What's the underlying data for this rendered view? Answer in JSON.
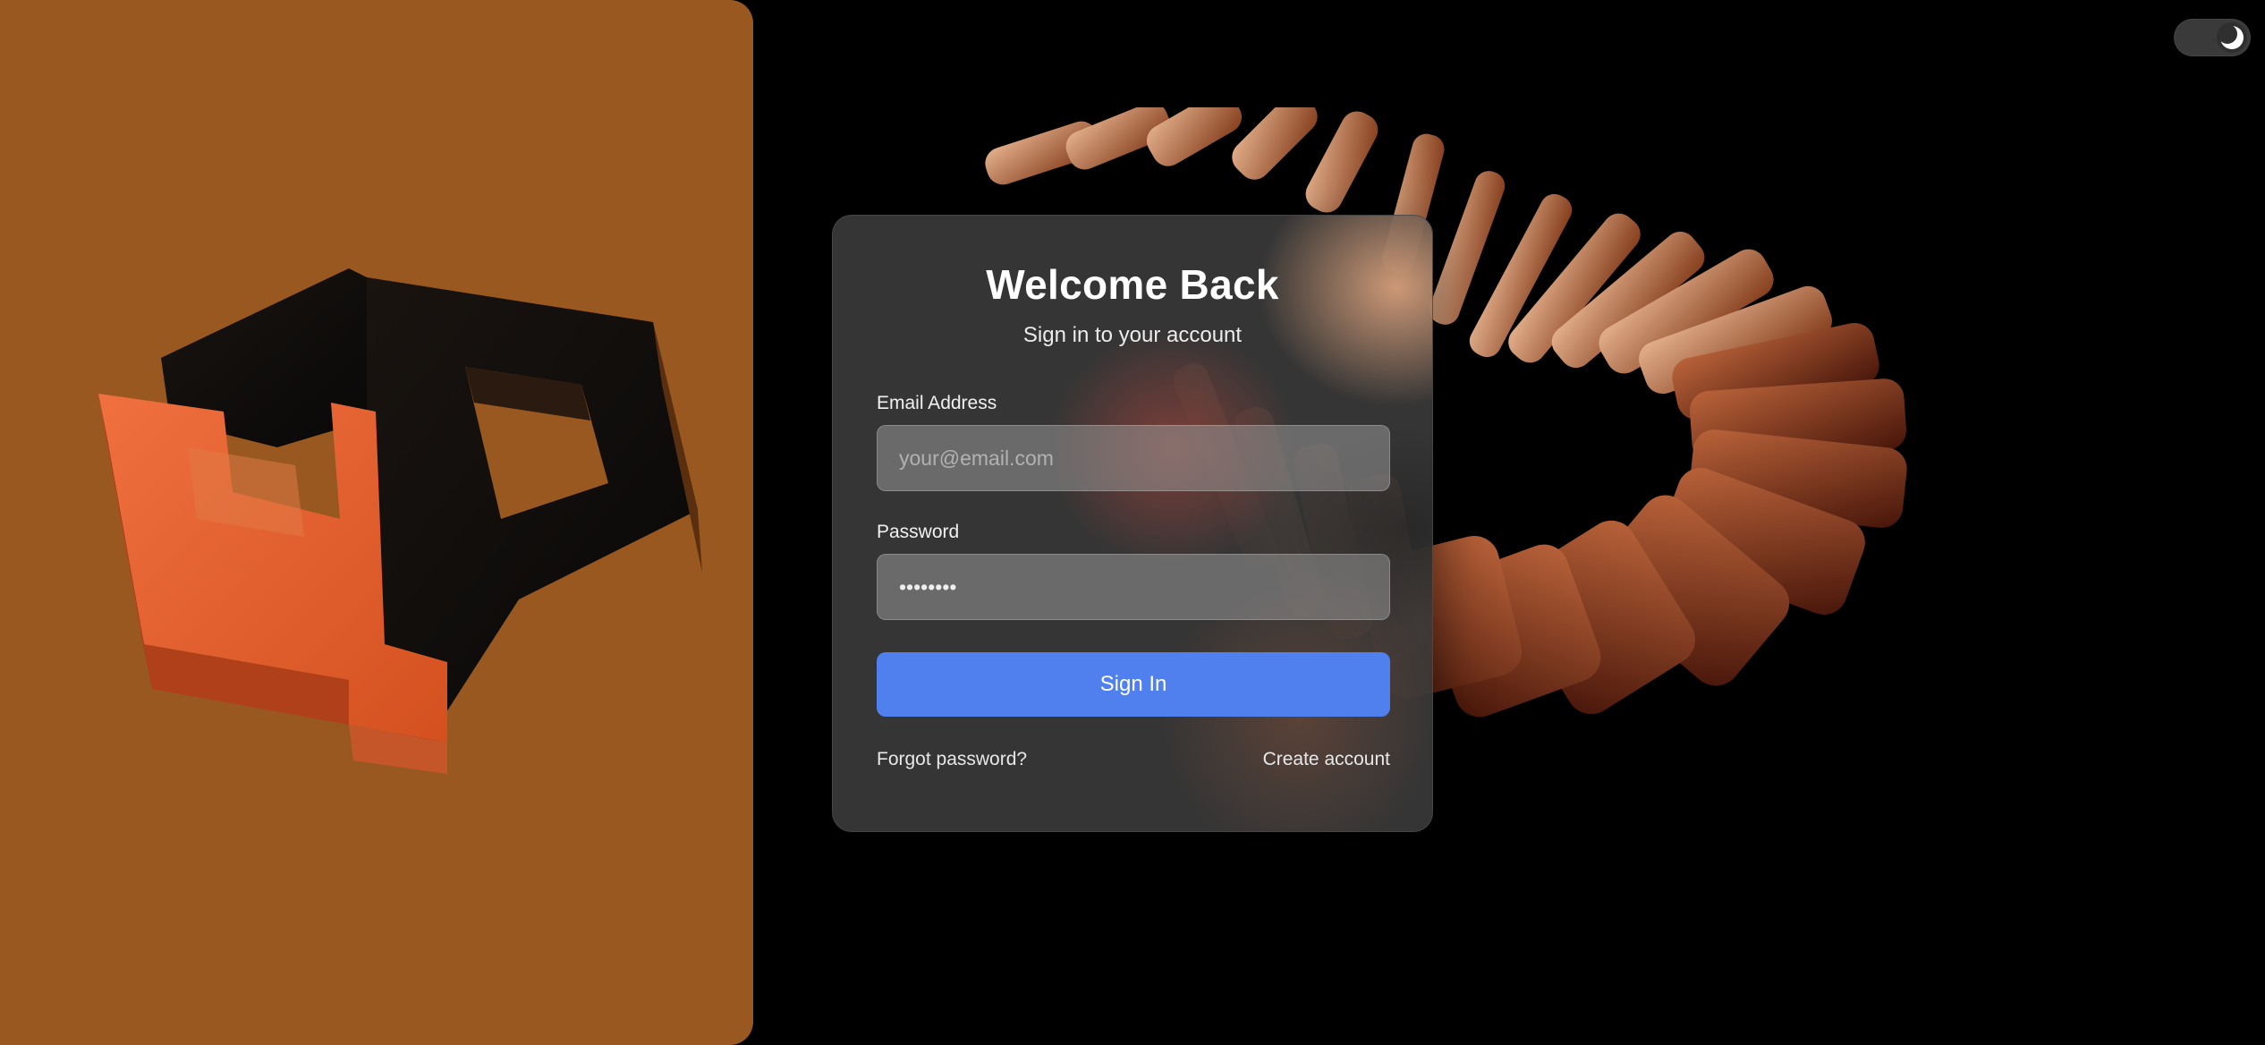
{
  "theme_toggle": {
    "icon": "moon-icon",
    "mode": "dark"
  },
  "brand": {
    "logo_text": "4P"
  },
  "login": {
    "title": "Welcome Back",
    "subtitle": "Sign in to your account",
    "email": {
      "label": "Email Address",
      "placeholder": "your@email.com",
      "value": ""
    },
    "password": {
      "label": "Password",
      "value": "••••••••"
    },
    "submit_label": "Sign In",
    "forgot_label": "Forgot password?",
    "create_label": "Create account"
  },
  "colors": {
    "brand_panel": "#98581f",
    "primary_button": "#4f80ed",
    "logo_orange": "#e8612e",
    "logo_dark": "#111111"
  }
}
